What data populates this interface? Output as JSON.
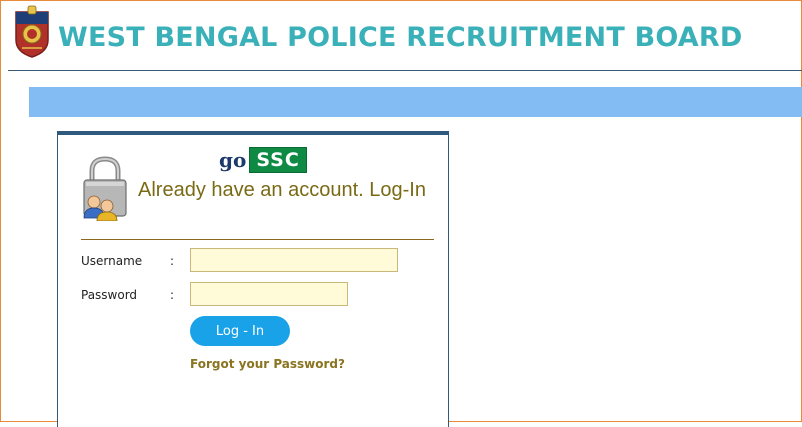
{
  "header": {
    "title": "WEST BENGAL POLICE RECRUITMENT BOARD",
    "emblem_icon": "police-emblem-icon"
  },
  "login": {
    "brand_go": "go",
    "brand_ssc": "SSC",
    "heading": "Already have an account. Log-In",
    "username_label": "Username",
    "password_label": "Password",
    "colon": ":",
    "username_value": "",
    "password_value": "",
    "submit_label": "Log - In",
    "forgot_label": "Forgot your Password?",
    "lock_icon": "lock-users-icon"
  },
  "colors": {
    "title": "#3ab0b8",
    "band": "#82bcf3",
    "panel_border": "#2f5a7e",
    "heading": "#7a6a14",
    "input_bg": "#fffbd9",
    "button": "#1aa2e8",
    "link": "#8a7420",
    "brand_green": "#0f8a44"
  }
}
